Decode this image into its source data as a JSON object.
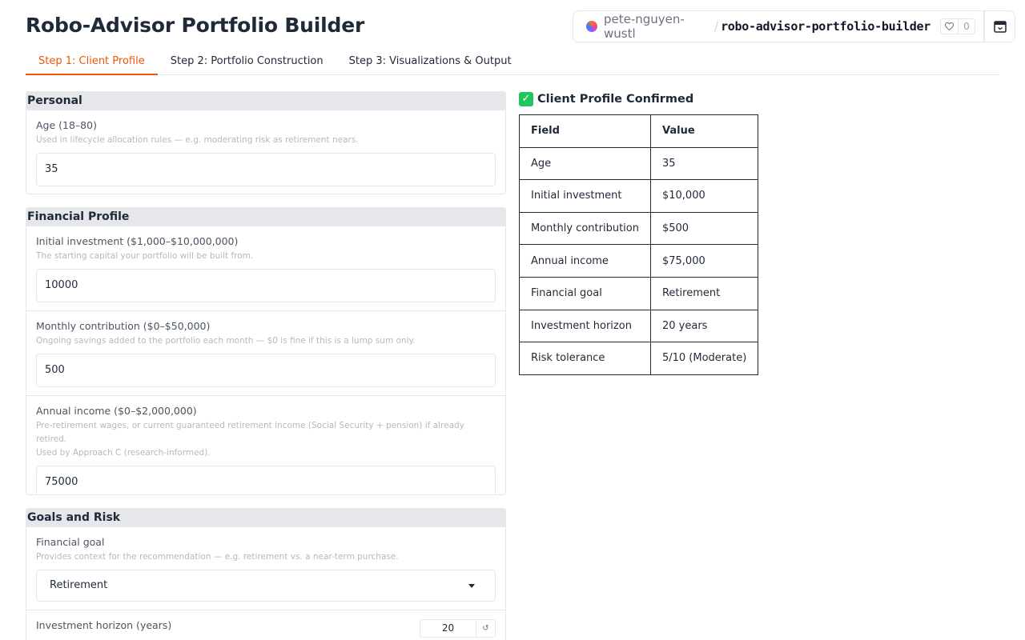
{
  "page": {
    "title": "Robo-Advisor Portfolio Builder"
  },
  "space_badge": {
    "owner": "pete-nguyen-wustl",
    "separator": "/",
    "repo": "robo-advisor-portfolio-builder",
    "likes": "0"
  },
  "tabs": [
    {
      "label": "Step 1: Client Profile",
      "active": true
    },
    {
      "label": "Step 2: Portfolio Construction",
      "active": false
    },
    {
      "label": "Step 3: Visualizations & Output",
      "active": false
    }
  ],
  "sections": {
    "personal": {
      "title": "Personal",
      "age": {
        "label": "Age (18–80)",
        "info": "Used in lifecycle allocation rules — e.g. moderating risk as retirement nears.",
        "value": "35"
      }
    },
    "financial": {
      "title": "Financial Profile",
      "initial": {
        "label": "Initial investment ($1,000–$10,000,000)",
        "info": "The starting capital your portfolio will be built from.",
        "value": "10000"
      },
      "monthly": {
        "label": "Monthly contribution ($0–$50,000)",
        "info": "Ongoing savings added to the portfolio each month — $0 is fine if this is a lump sum only.",
        "value": "500"
      },
      "income": {
        "label": "Annual income ($0–$2,000,000)",
        "info_line1": "Pre-retirement wages, or current guaranteed retirement income (Social Security + pension) if already retired.",
        "info_line2": "Used by Approach C (research-informed).",
        "value": "75000"
      }
    },
    "goals": {
      "title": "Goals and Risk",
      "goal": {
        "label": "Financial goal",
        "info": "Provides context for the recommendation — e.g. retirement vs. a near-term purchase.",
        "value": "Retirement"
      },
      "horizon": {
        "label": "Investment horizon (years)",
        "value": "20"
      }
    }
  },
  "confirm": {
    "title": "Client Profile Confirmed",
    "headers": [
      "Field",
      "Value"
    ],
    "rows": [
      [
        "Age",
        "35"
      ],
      [
        "Initial investment",
        "$10,000"
      ],
      [
        "Monthly contribution",
        "$500"
      ],
      [
        "Annual income",
        "$75,000"
      ],
      [
        "Financial goal",
        "Retirement"
      ],
      [
        "Investment horizon",
        "20 years"
      ],
      [
        "Risk tolerance",
        "5/10 (Moderate)"
      ]
    ]
  },
  "colors": {
    "accent": "#ea580c",
    "section_header": "#e5e7eb",
    "success": "#22c55e"
  }
}
